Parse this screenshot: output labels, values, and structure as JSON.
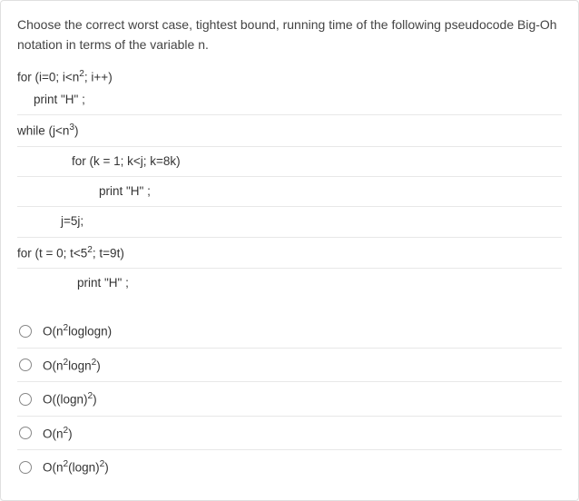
{
  "question": "Choose the correct worst case, tightest bound,  running time of the following pseudocode Big-Oh notation in terms of the variable n.",
  "code": {
    "l1a": "for (i=0; i<n",
    "l1b": "; i++)",
    "l2": "print \"H\" ;",
    "l3a": "while (j<n",
    "l3b": ")",
    "l4": "for (k = 1; k<j; k=8k)",
    "l5": "print \"H\" ;",
    "l6": "j=5j;",
    "l7a": "for (t = 0; t<5",
    "l7b": "; t=9t)",
    "l8": "print \"H\" ;"
  },
  "options": [
    {
      "pre": "O(n",
      "s": "2",
      "post": "loglogn)"
    },
    {
      "pre": "O(n",
      "s": "2",
      "post": "logn",
      "s2": "2",
      "post2": ")"
    },
    {
      "pre": "O((logn)",
      "s": "2",
      "post": ")"
    },
    {
      "pre": "O(n",
      "s": "2",
      "post": ")"
    },
    {
      "pre": "O(n",
      "s": "2",
      "post": "(logn)",
      "s2": "2",
      "post2": ")"
    }
  ]
}
